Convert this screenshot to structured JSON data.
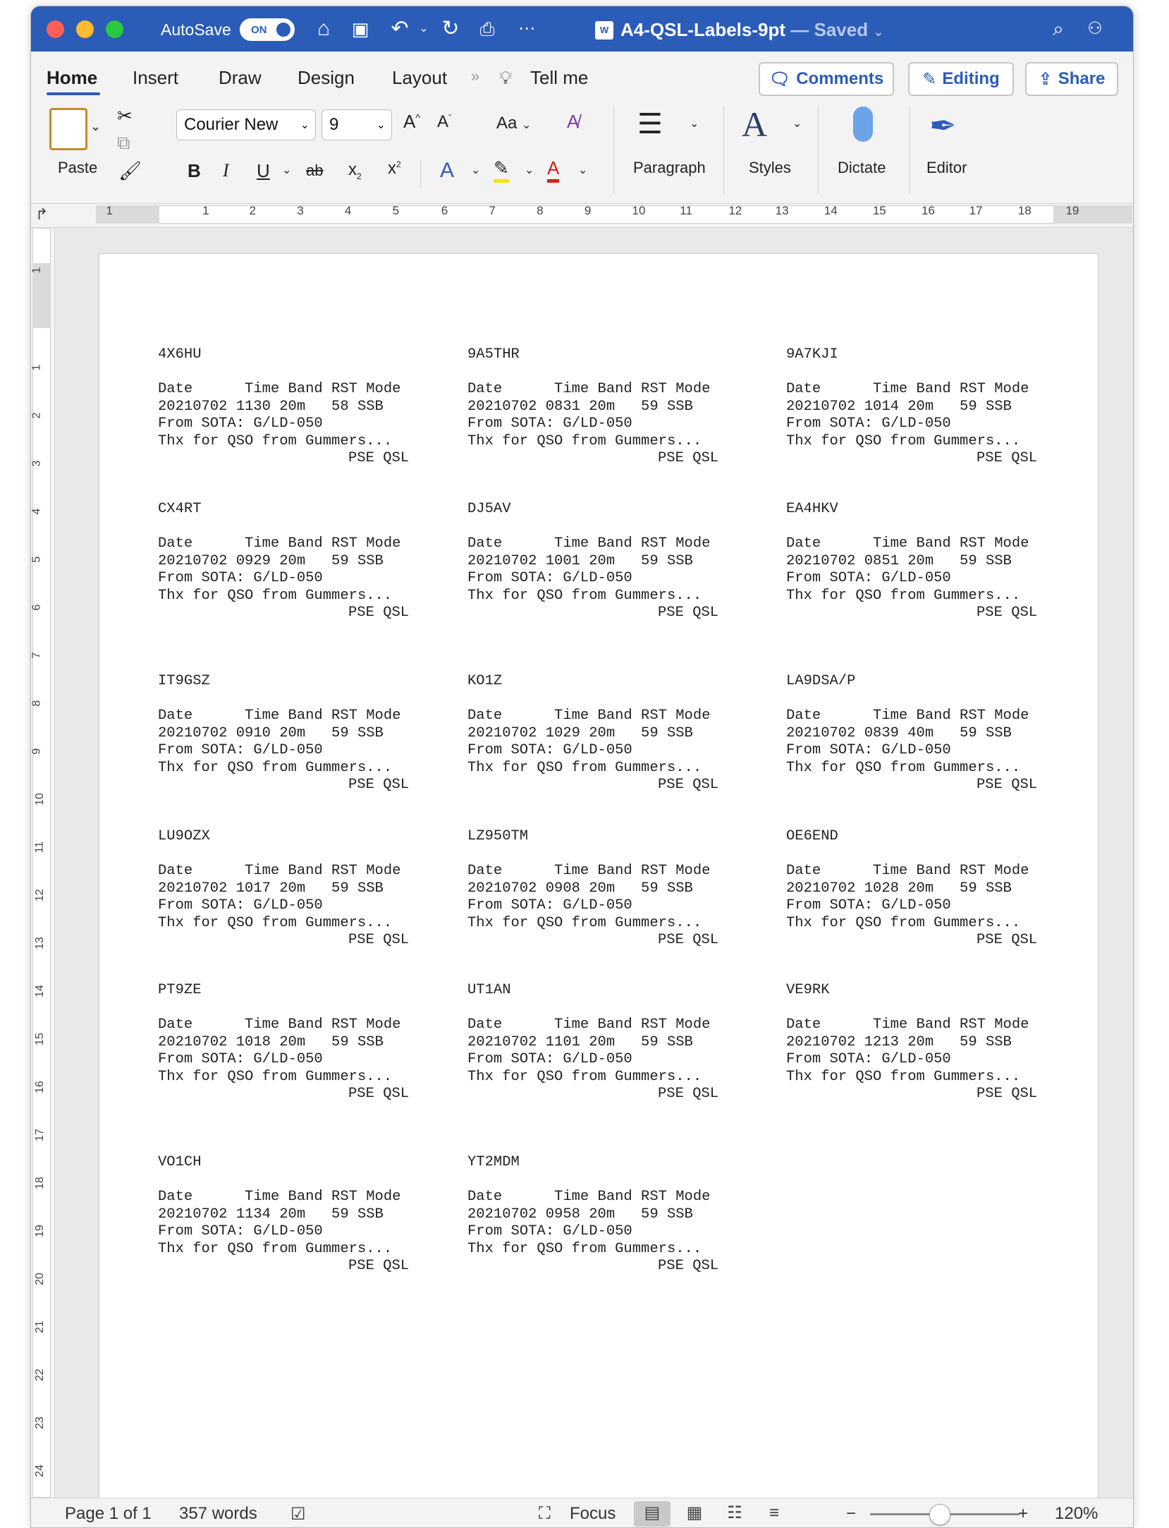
{
  "titlebar": {
    "autosave_label": "AutoSave",
    "autosave_state": "ON",
    "doc_name": "A4-QSL-Labels-9pt",
    "doc_status": "— Saved"
  },
  "tabs": {
    "home": "Home",
    "insert": "Insert",
    "draw": "Draw",
    "design": "Design",
    "layout": "Layout",
    "tell_me": "Tell me"
  },
  "actions": {
    "comments": "Comments",
    "editing": "Editing",
    "share": "Share"
  },
  "ribbon": {
    "paste": "Paste",
    "font_name": "Courier New",
    "font_size": "9",
    "change_case": "Aa",
    "paragraph": "Paragraph",
    "styles": "Styles",
    "dictate": "Dictate",
    "editor": "Editor"
  },
  "ruler": {
    "h_numbers": [
      "1",
      "1",
      "2",
      "3",
      "4",
      "5",
      "6",
      "7",
      "8",
      "9",
      "10",
      "11",
      "12",
      "13",
      "14",
      "15",
      "16",
      "17",
      "18",
      "19"
    ],
    "v_numbers": [
      "1",
      "1",
      "2",
      "3",
      "4",
      "5",
      "6",
      "7",
      "8",
      "9",
      "10",
      "11",
      "12",
      "13",
      "14",
      "15",
      "16",
      "17",
      "18",
      "19",
      "20",
      "21",
      "22",
      "23",
      "24"
    ]
  },
  "labels": {
    "header": "Date      Time Band RST Mode",
    "from": "From SOTA: G/LD-050",
    "thanks": "Thx for QSO from Gummers...",
    "pse": "PSE QSL",
    "items": [
      {
        "call": "4X6HU",
        "data": "20210702 1130 20m   58 SSB"
      },
      {
        "call": "9A5THR",
        "data": "20210702 0831 20m   59 SSB"
      },
      {
        "call": "9A7KJI",
        "data": "20210702 1014 20m   59 SSB"
      },
      {
        "call": "CX4RT",
        "data": "20210702 0929 20m   59 SSB"
      },
      {
        "call": "DJ5AV",
        "data": "20210702 1001 20m   59 SSB"
      },
      {
        "call": "EA4HKV",
        "data": "20210702 0851 20m   59 SSB"
      },
      {
        "call": "IT9GSZ",
        "data": "20210702 0910 20m   59 SSB"
      },
      {
        "call": "KO1Z",
        "data": "20210702 1029 20m   59 SSB"
      },
      {
        "call": "LA9DSA/P",
        "data": "20210702 0839 40m   59 SSB"
      },
      {
        "call": "LU9OZX",
        "data": "20210702 1017 20m   59 SSB"
      },
      {
        "call": "LZ950TM",
        "data": "20210702 0908 20m   59 SSB"
      },
      {
        "call": "OE6END",
        "data": "20210702 1028 20m   59 SSB"
      },
      {
        "call": "PT9ZE",
        "data": "20210702 1018 20m   59 SSB"
      },
      {
        "call": "UT1AN",
        "data": "20210702 1101 20m   59 SSB"
      },
      {
        "call": "VE9RK",
        "data": "20210702 1213 20m   59 SSB"
      },
      {
        "call": "VO1CH",
        "data": "20210702 1134 20m   59 SSB"
      },
      {
        "call": "YT2MDM",
        "data": "20210702 0958 20m   59 SSB"
      }
    ]
  },
  "statusbar": {
    "page": "Page 1 of 1",
    "words": "357 words",
    "focus": "Focus",
    "zoom": "120%"
  }
}
